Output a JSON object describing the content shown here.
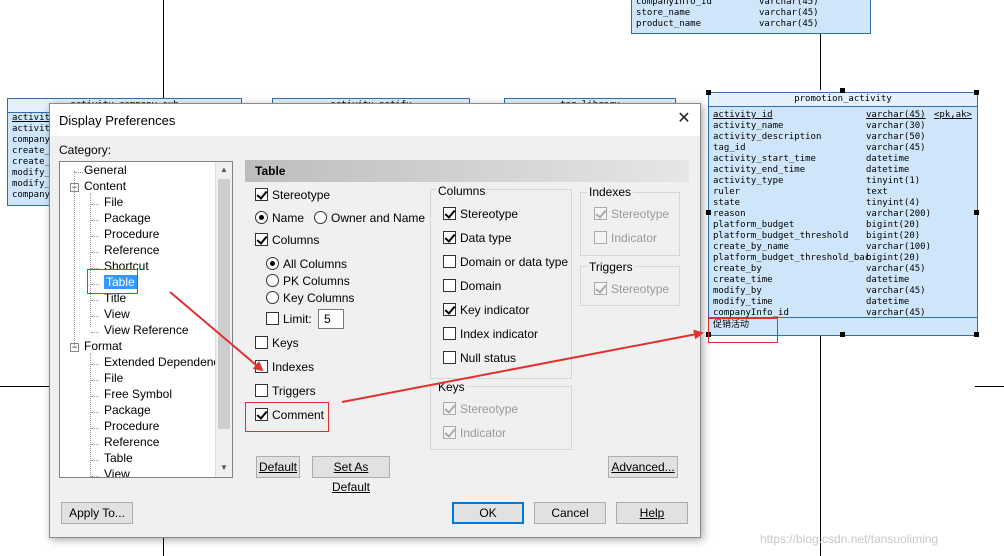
{
  "diagram": {
    "top_table": {
      "rows": [
        {
          "name": "companyInfo_id",
          "type": "varchar(45)"
        },
        {
          "name": "store_name",
          "type": "varchar(45)"
        },
        {
          "name": "product_name",
          "type": "varchar(45)"
        }
      ]
    },
    "left_table": {
      "title": "activity_company_sub",
      "rows": [
        "activit",
        "activit",
        "company",
        "create_b",
        "create_t",
        "modify_b",
        "modify_t",
        "company"
      ]
    },
    "mid_table_1_title": "activity_notify",
    "mid_table_2_title": "tag_library",
    "promotion_table": {
      "title": "promotion_activity",
      "rows": [
        {
          "name": "activity_id",
          "type": "varchar(45)",
          "key": "<pk,ak>"
        },
        {
          "name": "activity_name",
          "type": "varchar(30)",
          "key": ""
        },
        {
          "name": "activity_description",
          "type": "varchar(50)",
          "key": ""
        },
        {
          "name": "tag_id",
          "type": "varchar(45)",
          "key": ""
        },
        {
          "name": "activity_start_time",
          "type": "datetime",
          "key": ""
        },
        {
          "name": "activity_end_time",
          "type": "datetime",
          "key": ""
        },
        {
          "name": "activity_type",
          "type": "tinyint(1)",
          "key": ""
        },
        {
          "name": "ruler",
          "type": "text",
          "key": ""
        },
        {
          "name": "state",
          "type": "tinyint(4)",
          "key": ""
        },
        {
          "name": "reason",
          "type": "varchar(200)",
          "key": ""
        },
        {
          "name": "platform_budget",
          "type": "bigint(20)",
          "key": ""
        },
        {
          "name": "platform_budget_threshold",
          "type": "bigint(20)",
          "key": ""
        },
        {
          "name": "create_by_name",
          "type": "varchar(100)",
          "key": ""
        },
        {
          "name": "platform_budget_threshold_bac",
          "type": "bigint(20)",
          "key": ""
        },
        {
          "name": "create_by",
          "type": "varchar(45)",
          "key": ""
        },
        {
          "name": "create_time",
          "type": "datetime",
          "key": ""
        },
        {
          "name": "modify_by",
          "type": "varchar(45)",
          "key": ""
        },
        {
          "name": "modify_time",
          "type": "datetime",
          "key": ""
        },
        {
          "name": "companyInfo_id",
          "type": "varchar(45)",
          "key": ""
        }
      ],
      "comment": "促销活动"
    }
  },
  "dialog": {
    "title": "Display Preferences",
    "close_glyph": "✕",
    "category_label": "Category:",
    "tree": [
      {
        "label": "General",
        "level": 1
      },
      {
        "label": "Content",
        "level": 0
      },
      {
        "label": "File",
        "level": 2
      },
      {
        "label": "Package",
        "level": 2
      },
      {
        "label": "Procedure",
        "level": 2
      },
      {
        "label": "Reference",
        "level": 2
      },
      {
        "label": "Shortcut",
        "level": 2
      },
      {
        "label": "Table",
        "level": 2
      },
      {
        "label": "Title",
        "level": 2
      },
      {
        "label": "View",
        "level": 2
      },
      {
        "label": "View Reference",
        "level": 2
      },
      {
        "label": "Format",
        "level": 0
      },
      {
        "label": "Extended Dependency",
        "level": 2
      },
      {
        "label": "File",
        "level": 2
      },
      {
        "label": "Free Symbol",
        "level": 2
      },
      {
        "label": "Package",
        "level": 2
      },
      {
        "label": "Procedure",
        "level": 2
      },
      {
        "label": "Reference",
        "level": 2
      },
      {
        "label": "Table",
        "level": 2
      },
      {
        "label": "View",
        "level": 2
      }
    ],
    "panel_title": "Table",
    "stereotype": "Stereotype",
    "name_radio": "Name",
    "owner_name_radio": "Owner and Name",
    "columns": "Columns",
    "all_columns": "All Columns",
    "pk_columns": "PK Columns",
    "key_columns": "Key Columns",
    "limit": "Limit:",
    "limit_value": "5",
    "keys": "Keys",
    "indexes": "Indexes",
    "triggers": "Triggers",
    "comment": "Comment",
    "columns_group": {
      "title": "Columns",
      "items": [
        "Stereotype",
        "Data type",
        "Domain or data type",
        "Domain",
        "Key indicator",
        "Index indicator",
        "Null status"
      ]
    },
    "keys_group": {
      "title": "Keys",
      "items": [
        "Stereotype",
        "Indicator"
      ]
    },
    "indexes_group": {
      "title": "Indexes",
      "items": [
        "Stereotype",
        "Indicator"
      ]
    },
    "triggers_group": {
      "title": "Triggers",
      "items": [
        "Stereotype"
      ]
    },
    "buttons": {
      "default": "Default",
      "set_as_default": "Set As Default",
      "advanced": "Advanced...",
      "apply_to": "Apply To...",
      "ok": "OK",
      "cancel": "Cancel",
      "help": "Help"
    }
  },
  "watermark": "https://blog.csdn.net/tansuoliming",
  "colors": {
    "annotation": "#e03030",
    "selection": "#3399ff",
    "table_fill": "#cfe6fa"
  }
}
